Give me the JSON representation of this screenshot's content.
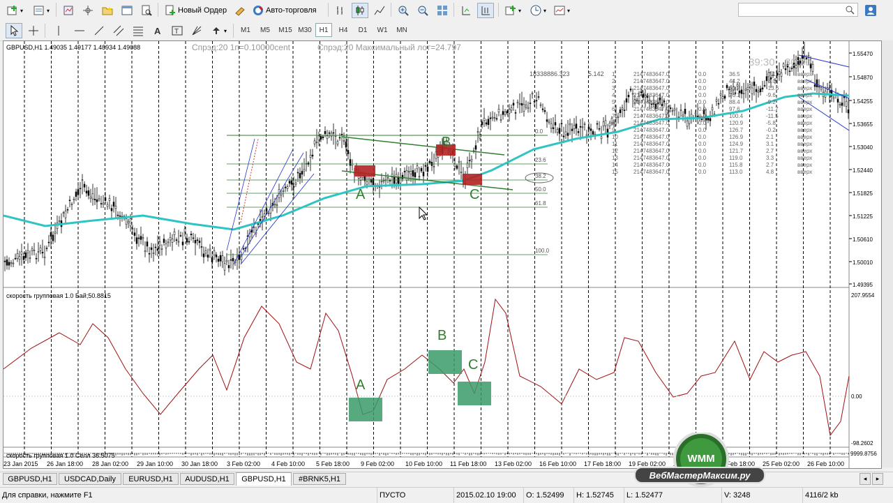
{
  "toolbar": {
    "new_order": "Новый Ордер",
    "auto_trading": "Авто-торговля",
    "timeframes": [
      "M1",
      "M5",
      "M15",
      "M30",
      "H1",
      "H4",
      "D1",
      "W1",
      "MN"
    ],
    "active_timeframe": "H1"
  },
  "chart": {
    "symbol_info": "GBPUSD,H1  1.49035 1.49177 1.48934 1.49088",
    "spread_info": "Спрэд:20  1п=0.10000cent",
    "spread_info2": "Спрэд:20  Максимальный лот=24.797",
    "timer": "39:30",
    "timer2": "30:30",
    "big_number": "18338886.323",
    "small_number": "5.142",
    "price_ticks": [
      "1.55470",
      "1.54870",
      "1.54255",
      "1.53655",
      "1.53040",
      "1.52440",
      "1.51825",
      "1.51225",
      "1.50610",
      "1.50010",
      "1.49395"
    ],
    "fib_levels": [
      "0.0",
      "23.6",
      "38.2",
      "50.0",
      "61.8",
      "100.0"
    ],
    "point_labels": {
      "a": "A",
      "b": "B",
      "c": "C"
    },
    "table_rows": [
      [
        "1",
        "2147483647.0",
        "0.0",
        "36.5",
        "-7.1",
        "вверх"
      ],
      [
        "2",
        "2147483647.0",
        "0.0",
        "44.2",
        "-3.0",
        "вверх"
      ],
      [
        "3",
        "2147483647.0",
        "0.0",
        "60.7",
        "-13.6",
        "вверх"
      ],
      [
        "4",
        "2147483647.0",
        "0.0",
        "76.1",
        "-9.6",
        "вверх"
      ],
      [
        "5",
        "2147483647.0",
        "0.0",
        "88.4",
        "-9.2",
        "вверх"
      ],
      [
        "6",
        "2147483647.0",
        "0.0",
        "97.6",
        "-11.7",
        "вверх"
      ],
      [
        "7",
        "2147483647.0",
        "0.0",
        "100.4",
        "-11.5",
        "вверх"
      ],
      [
        "8",
        "2147483647.0",
        "0.0",
        "120.9",
        "-5.8",
        "вверх"
      ],
      [
        "9",
        "2147483647.0",
        "0.0",
        "126.7",
        "-0.2",
        "вверх"
      ],
      [
        "10",
        "2147483647.0",
        "0.0",
        "126.9",
        "2.1",
        "вверх"
      ],
      [
        "11",
        "2147483647.0",
        "0.0",
        "124.9",
        "3.1",
        "вверх"
      ],
      [
        "12",
        "2147483647.0",
        "0.0",
        "121.7",
        "2.7",
        "вверх"
      ],
      [
        "13",
        "2147483647.0",
        "0.0",
        "119.0",
        "3.3",
        "вверх"
      ],
      [
        "14",
        "2147483647.0",
        "0.0",
        "115.8",
        "2.7",
        "вверх"
      ],
      [
        "15",
        "2147483647.0",
        "0.0",
        "113.0",
        "4.8",
        "вверх"
      ]
    ]
  },
  "indicator": {
    "label": "скорость групповая 1.0 Бай;50.8815",
    "label2": "скорость групповая 1.0 Селл 36.5075",
    "scale_ticks": [
      "207.9554",
      "0.00",
      "-98.2602"
    ],
    "bottom_tick": "9999.8756"
  },
  "time_axis": [
    "23 Jan 2015",
    "26 Jan 18:00",
    "28 Jan 02:00",
    "29 Jan 10:00",
    "30 Jan 18:00",
    "3 Feb 02:00",
    "4 Feb 10:00",
    "5 Feb 18:00",
    "9 Feb 02:00",
    "10 Feb 10:00",
    "11 Feb 18:00",
    "13 Feb 02:00",
    "16 Feb 10:00",
    "17 Feb 18:00",
    "19 Feb 02:00",
    "20 Feb 10:00",
    "23 Feb 18:00",
    "25 Feb 02:00",
    "26 Feb 10:00"
  ],
  "tabs": [
    "GBPUSD,H1",
    "USDCAD,Daily",
    "EURUSD,H1",
    "AUDUSD,H1",
    "GBPUSD,H1",
    "#BRNK5,H1"
  ],
  "active_tab": 4,
  "status": {
    "help": "Для справки, нажмите F1",
    "profile": "ПУСТО",
    "datetime": "2015.02.10 19:00",
    "open": "O: 1.52499",
    "high": "H: 1.52745",
    "low": "L: 1.52477",
    "volume": "V: 3248",
    "traffic": "4116/2 kb"
  },
  "watermark": {
    "logo": "WMM",
    "site": "ВебМастерМаксим.ру"
  },
  "colors": {
    "ma": "#2ec4c4",
    "fib": "#2f7f2f",
    "red_box": "#b22222",
    "green_box": "#3a9a6a",
    "osc": "#a01010"
  }
}
